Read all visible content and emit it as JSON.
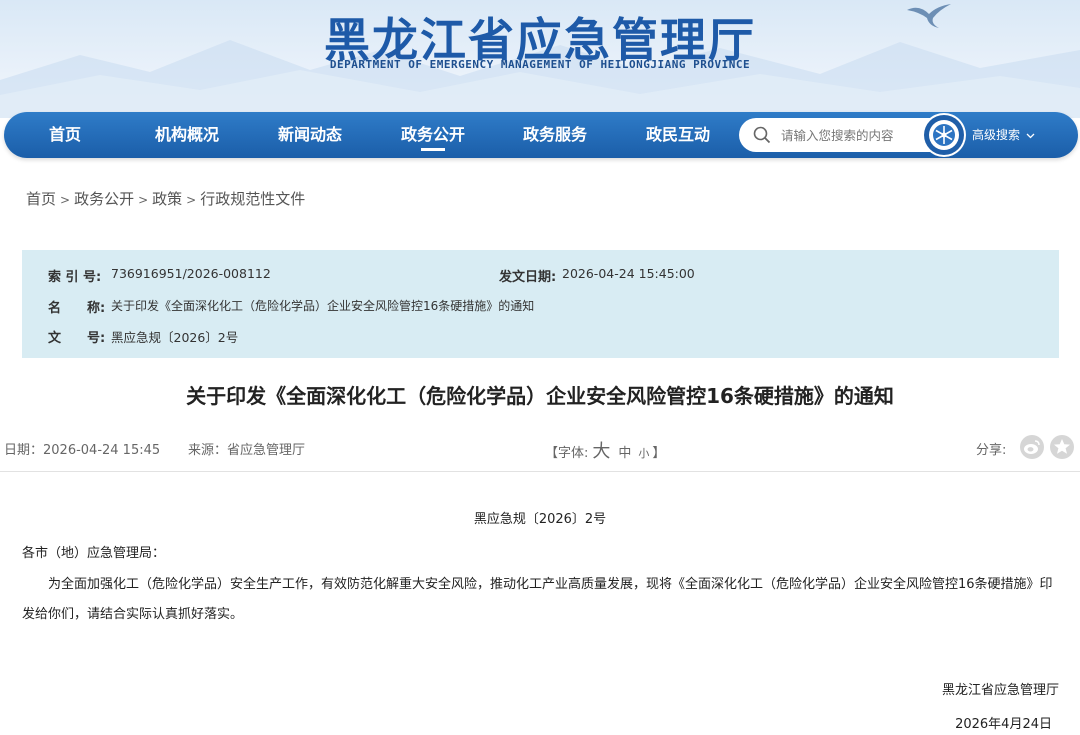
{
  "header": {
    "title": "黑龙江省应急管理厅",
    "subtitle": "DEPARTMENT OF EMERGENCY MANAGEMENT OF HEILONGJIANG PROVINCE"
  },
  "nav": {
    "items": [
      {
        "label": "首页"
      },
      {
        "label": "机构概况"
      },
      {
        "label": "新闻动态"
      },
      {
        "label": "政务公开"
      },
      {
        "label": "政务服务"
      },
      {
        "label": "政民互动"
      }
    ],
    "active_item": "政务公开",
    "search": {
      "placeholder": "请输入您搜索的内容",
      "icon": "search-icon"
    },
    "advanced_search_label": "高级搜索"
  },
  "breadcrumb": [
    "首页",
    "政务公开",
    "政策",
    "行政规范性文件"
  ],
  "metadata": {
    "index_label": "索 引 号:",
    "index_value": "736916951/2026-008112",
    "date_label": "发文日期:",
    "date_value": "2026-04-24 15:45:00",
    "name_label": "名　　称:",
    "name_value": "关于印发《全面深化化工（危险化学品）企业安全风险管控16条硬措施》的通知",
    "docno_label": "文　　号:",
    "docno_value": "黑应急规〔2026〕2号"
  },
  "article": {
    "title": "关于印发《全面深化化工（危险化学品）企业安全风险管控16条硬措施》的通知",
    "date_text": "日期：2026-04-24 15:45",
    "source_text": "来源：省应急管理厅",
    "font_size_open": "【字体:",
    "font_size_big": "大",
    "font_size_mid": "中",
    "font_size_small": "小",
    "font_size_close": "】",
    "share_label": "分享:",
    "doc_number": "黑应急规〔2026〕2号",
    "addressee": "各市（地）应急管理局：",
    "body": "为全面加强化工（危险化学品）安全生产工作，有效防范化解重大安全风险，推动化工产业高质量发展，现将《全面深化化工（危险化学品）企业安全风险管控16条硬措施》印发给你们，请结合实际认真抓好落实。",
    "signature_org": "黑龙江省应急管理厅",
    "signature_date": "2026年4月24日"
  },
  "colors": {
    "brand_blue": "#1e5aa8",
    "nav_blue": "#2068b3",
    "meta_bg": "#d8ecf3"
  }
}
